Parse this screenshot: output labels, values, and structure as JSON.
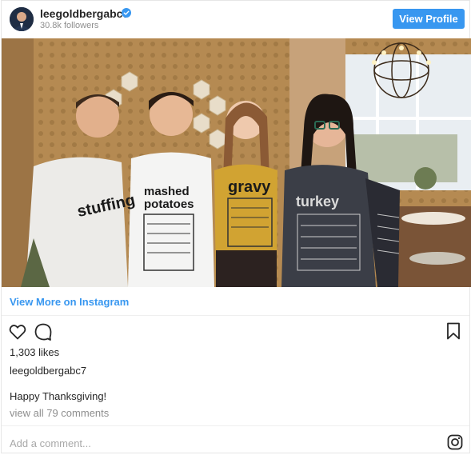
{
  "header": {
    "username": "leegoldbergabc7",
    "followers": "30.8k followers",
    "view_profile_label": "View Profile"
  },
  "post": {
    "view_more_label": "View More on Instagram",
    "likes": "1,303 likes",
    "author": "leegoldbergabc7",
    "caption": "Happy Thanksgiving!",
    "comments_link": "view all 79 comments",
    "add_comment_placeholder": "Add a comment..."
  },
  "photo_text": {
    "shirt1": "stuffing",
    "shirt2_line1": "mashed",
    "shirt2_line2": "potatoes",
    "shirt3": "gravy",
    "shirt4": "turkey"
  },
  "icons": {
    "verified": "verified-badge-icon",
    "like": "heart-icon",
    "comment": "comment-icon",
    "save": "bookmark-icon",
    "instagram": "instagram-icon"
  },
  "colors": {
    "accent": "#3897f0",
    "muted": "#8e8e8e"
  }
}
